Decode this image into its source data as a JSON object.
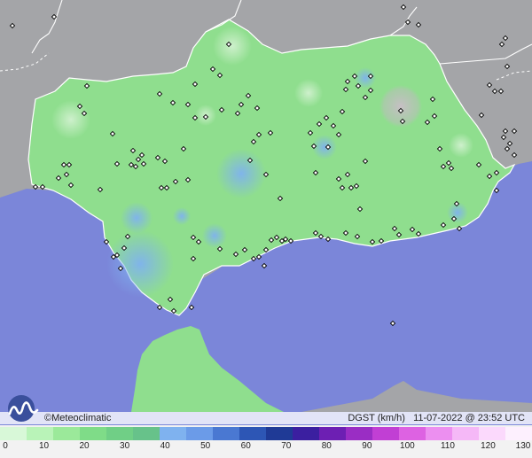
{
  "brand": {
    "name": "©Meteoclimatic",
    "logo_icon": "meteoclimatic-logo-icon"
  },
  "product": {
    "variable": "DGST (km/h)",
    "timestamp": "11-07-2022 @ 23:52 UTC"
  },
  "colors": {
    "sea": "#7b86d9",
    "land_outside": "#a4a5a8",
    "region_base": "#8fde8e",
    "high_gust": "#7fb2ef",
    "mountain_high": "#c7bfc5",
    "station_marker": "#000000",
    "border_line": "#ffffff"
  },
  "legend": {
    "labels": [
      "0",
      "10",
      "20",
      "30",
      "40",
      "50",
      "60",
      "70",
      "80",
      "90",
      "100",
      "110",
      "120",
      "130"
    ],
    "colors": [
      "#d8f8d8",
      "#b9f3b8",
      "#9be99a",
      "#7fdc88",
      "#70cf86",
      "#67c28a",
      "#7fb2ef",
      "#6b9be8",
      "#4a78d2",
      "#2d56b5",
      "#1f3a96",
      "#3b1fa0",
      "#6d1fb3",
      "#9a2dc4",
      "#c13fd4",
      "#dd62e2",
      "#ec8ff0",
      "#f5b8f7",
      "#fbd9fc",
      "#fdf0fe"
    ]
  },
  "map": {
    "stations": [
      [
        14,
        29
      ],
      [
        61,
        19
      ],
      [
        40,
        211
      ],
      [
        48,
        211
      ],
      [
        66,
        201
      ],
      [
        75,
        197
      ],
      [
        78,
        186
      ],
      [
        80,
        209
      ],
      [
        72,
        186
      ],
      [
        90,
        120
      ],
      [
        95,
        128
      ],
      [
        98,
        97
      ],
      [
        113,
        214
      ],
      [
        120,
        273
      ],
      [
        128,
        290
      ],
      [
        136,
        303
      ],
      [
        132,
        288
      ],
      [
        140,
        280
      ],
      [
        144,
        267
      ],
      [
        127,
        151
      ],
      [
        132,
        185
      ],
      [
        148,
        186
      ],
      [
        153,
        188
      ],
      [
        156,
        180
      ],
      [
        150,
        170
      ],
      [
        160,
        175
      ],
      [
        162,
        185
      ],
      [
        178,
        178
      ],
      [
        186,
        182
      ],
      [
        182,
        212
      ],
      [
        188,
        212
      ],
      [
        198,
        205
      ],
      [
        212,
        203
      ],
      [
        207,
        168
      ],
      [
        212,
        118
      ],
      [
        220,
        133
      ],
      [
        195,
        116
      ],
      [
        180,
        106
      ],
      [
        220,
        95
      ],
      [
        240,
        78
      ],
      [
        248,
        85
      ],
      [
        258,
        50
      ],
      [
        232,
        132
      ],
      [
        250,
        124
      ],
      [
        268,
        128
      ],
      [
        272,
        118
      ],
      [
        280,
        108
      ],
      [
        290,
        122
      ],
      [
        292,
        152
      ],
      [
        305,
        150
      ],
      [
        286,
        160
      ],
      [
        282,
        181
      ],
      [
        300,
        197
      ],
      [
        316,
        224
      ],
      [
        350,
        150
      ],
      [
        354,
        165
      ],
      [
        370,
        166
      ],
      [
        360,
        140
      ],
      [
        368,
        133
      ],
      [
        376,
        142
      ],
      [
        382,
        152
      ],
      [
        386,
        126
      ],
      [
        390,
        101
      ],
      [
        392,
        92
      ],
      [
        400,
        86
      ],
      [
        404,
        97
      ],
      [
        412,
        110
      ],
      [
        418,
        102
      ],
      [
        418,
        86
      ],
      [
        392,
        197
      ],
      [
        382,
        202
      ],
      [
        386,
        212
      ],
      [
        396,
        212
      ],
      [
        402,
        210
      ],
      [
        412,
        182
      ],
      [
        406,
        236
      ],
      [
        356,
        195
      ],
      [
        356,
        263
      ],
      [
        362,
        267
      ],
      [
        370,
        270
      ],
      [
        390,
        263
      ],
      [
        403,
        267
      ],
      [
        420,
        273
      ],
      [
        430,
        272
      ],
      [
        445,
        258
      ],
      [
        465,
        259
      ],
      [
        472,
        264
      ],
      [
        500,
        254
      ],
      [
        512,
        247
      ],
      [
        306,
        271
      ],
      [
        300,
        282
      ],
      [
        292,
        290
      ],
      [
        286,
        292
      ],
      [
        298,
        300
      ],
      [
        312,
        268
      ],
      [
        318,
        272
      ],
      [
        322,
        270
      ],
      [
        328,
        272
      ],
      [
        266,
        287
      ],
      [
        276,
        282
      ],
      [
        218,
        268
      ],
      [
        224,
        273
      ],
      [
        218,
        292
      ],
      [
        248,
        281
      ],
      [
        180,
        347
      ],
      [
        192,
        338
      ],
      [
        196,
        351
      ],
      [
        216,
        347
      ],
      [
        452,
        125
      ],
      [
        454,
        137
      ],
      [
        482,
        138
      ],
      [
        488,
        112
      ],
      [
        490,
        131
      ],
      [
        496,
        168
      ],
      [
        506,
        184
      ],
      [
        500,
        188
      ],
      [
        509,
        190
      ],
      [
        515,
        230
      ],
      [
        518,
        258
      ],
      [
        540,
        186
      ],
      [
        552,
        199
      ],
      [
        560,
        195
      ],
      [
        560,
        215
      ],
      [
        568,
        155
      ],
      [
        570,
        148
      ],
      [
        575,
        162
      ],
      [
        572,
        168
      ],
      [
        580,
        175
      ],
      [
        566,
        50
      ],
      [
        570,
        43
      ],
      [
        552,
        96
      ],
      [
        558,
        103
      ],
      [
        565,
        103
      ],
      [
        543,
        130
      ],
      [
        572,
        75
      ],
      [
        580,
        148
      ],
      [
        472,
        28
      ],
      [
        455,
        8
      ],
      [
        460,
        25
      ],
      [
        450,
        265
      ],
      [
        443,
        365
      ]
    ]
  }
}
